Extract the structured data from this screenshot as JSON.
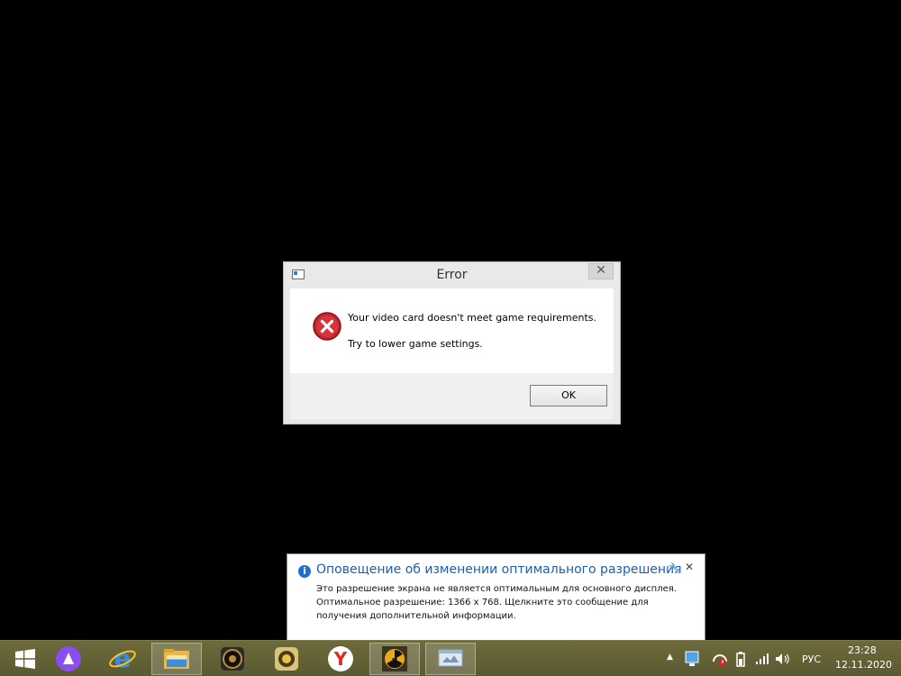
{
  "dialog": {
    "title": "Error",
    "close_glyph": "✕",
    "message_line1": "Your video card doesn't meet game requirements.",
    "message_line2": "Try to lower game settings.",
    "ok_label": "OK"
  },
  "notification": {
    "title": "Оповещение об изменении оптимального разрешения",
    "wrench_glyph": "🔧",
    "close_glyph": "✕",
    "info_glyph": "i",
    "body_line1": "Это разрешение экрана не является оптимальным для основного дисплея.",
    "body_line2": "Оптимальное разрешение: 1366 x 768. Щелкните это сообщение для",
    "body_line3": "получения дополнительной информации."
  },
  "taskbar": {
    "apps": [
      {
        "name": "start-button",
        "icon": "windows-logo-icon"
      },
      {
        "name": "alice-assistant",
        "icon": "alice-icon"
      },
      {
        "name": "internet-explorer",
        "icon": "ie-icon"
      },
      {
        "name": "file-explorer",
        "icon": "folder-icon"
      },
      {
        "name": "speaker-app",
        "icon": "speaker-icon"
      },
      {
        "name": "game-app",
        "icon": "game-icon"
      },
      {
        "name": "yandex-browser",
        "icon": "yandex-icon"
      },
      {
        "name": "radiation-game",
        "icon": "radiation-icon"
      },
      {
        "name": "system-window",
        "icon": "window-icon"
      }
    ],
    "tray": {
      "up_arrow": "▲",
      "language": "РУС",
      "time": "23:28",
      "date": "12.11.2020"
    }
  },
  "colors": {
    "desktop": "#000000",
    "taskbar": "#5b5930",
    "notification_title": "#1a5fb4",
    "error_red": "#c0262e"
  }
}
